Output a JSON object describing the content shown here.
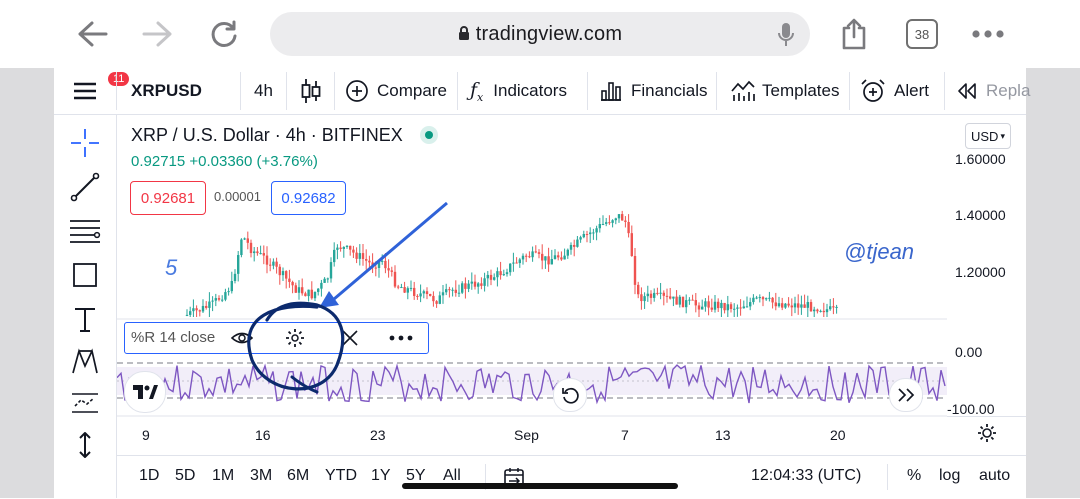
{
  "browser": {
    "url": "tradingview.com",
    "tab_count": "38"
  },
  "toolbar": {
    "badge": "11",
    "symbol": "XRPUSD",
    "interval": "4h",
    "compare": "Compare",
    "indicators": "Indicators",
    "financials": "Financials",
    "templates": "Templates",
    "alert": "Alert",
    "replay": "Repla"
  },
  "legend": {
    "title": "XRP / U.S. Dollar · 4h · BITFINEX",
    "change": "0.92715 +0.03360 (+3.76%)",
    "sell_price": "0.92681",
    "spread": "0.00001",
    "buy_price": "0.92682",
    "annotation_number": "5",
    "watermark": "@tjean"
  },
  "price_scale": {
    "currency": "USD",
    "labels": [
      "1.60000",
      "1.40000",
      "1.20000"
    ]
  },
  "indicator": {
    "label": "%R 14 close",
    "labels": [
      "0.00",
      "-100.00"
    ]
  },
  "time_axis": {
    "labels": [
      "9",
      "16",
      "23",
      "Sep",
      "7",
      "13",
      "20"
    ]
  },
  "bottom_bar": {
    "ranges": [
      "1D",
      "5D",
      "1M",
      "3M",
      "6M",
      "YTD",
      "1Y",
      "5Y",
      "All"
    ],
    "clock": "12:04:33 (UTC)",
    "percent": "%",
    "log": "log",
    "auto": "auto"
  },
  "colors": {
    "up": "#26a69a",
    "down": "#ef5350",
    "indicator": "#7e57c2",
    "annotation": "#2f62d8"
  }
}
